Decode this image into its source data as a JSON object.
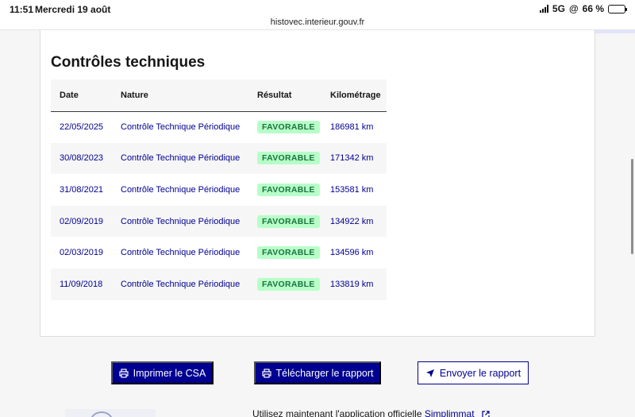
{
  "status_bar": {
    "time": "11:51",
    "date": "Mercredi 19 août",
    "network": "5G",
    "battery": "66 %",
    "url": "histovec.interieur.gouv.fr"
  },
  "card": {
    "title": "Contrôles techniques",
    "table": {
      "headers": [
        "Date",
        "Nature",
        "Résultat",
        "Kilométrage"
      ],
      "rows": [
        {
          "date": "22/05/2025",
          "nature": "Contrôle Technique Périodique",
          "result": "FAVORABLE",
          "km": "186981 km"
        },
        {
          "date": "30/08/2023",
          "nature": "Contrôle Technique Périodique",
          "result": "FAVORABLE",
          "km": "171342 km"
        },
        {
          "date": "31/08/2021",
          "nature": "Contrôle Technique Périodique",
          "result": "FAVORABLE",
          "km": "153581 km"
        },
        {
          "date": "02/09/2019",
          "nature": "Contrôle Technique Périodique",
          "result": "FAVORABLE",
          "km": "134922 km"
        },
        {
          "date": "02/03/2019",
          "nature": "Contrôle Technique Périodique",
          "result": "FAVORABLE",
          "km": "134596 km"
        },
        {
          "date": "11/09/2018",
          "nature": "Contrôle Technique Périodique",
          "result": "FAVORABLE",
          "km": "133819 km"
        }
      ]
    }
  },
  "actions": {
    "print": "Imprimer le CSA",
    "download": "Télécharger le rapport",
    "send": "Envoyer le rapport"
  },
  "bottom": {
    "text": "Utilisez maintenant l'application officielle ",
    "link": "Simplimmat"
  },
  "colors": {
    "primary": "#000091",
    "success_bg": "#b8fec9",
    "success_text": "#18753c"
  }
}
